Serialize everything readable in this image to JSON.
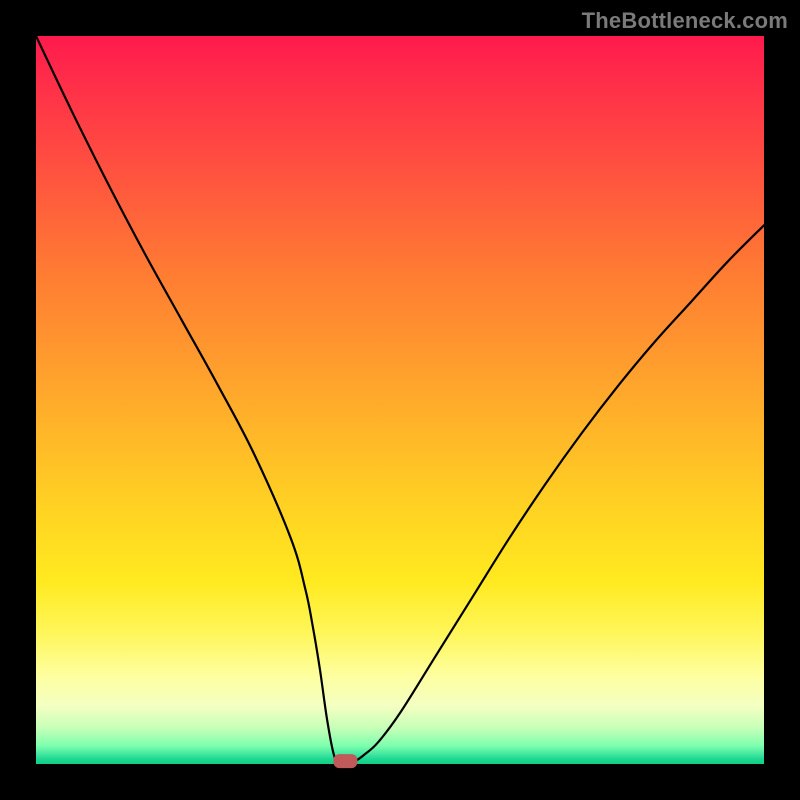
{
  "watermark": "TheBottleneck.com",
  "chart_data": {
    "type": "line",
    "title": "",
    "xlabel": "",
    "ylabel": "",
    "xlim": [
      0,
      100
    ],
    "ylim": [
      0,
      100
    ],
    "grid": false,
    "series": [
      {
        "name": "curve",
        "x": [
          0,
          5,
          10,
          15,
          20,
          25,
          30,
          35,
          37,
          38,
          39,
          40,
          41,
          42,
          43,
          44,
          45,
          47,
          50,
          55,
          60,
          65,
          70,
          75,
          80,
          85,
          90,
          95,
          100
        ],
        "values": [
          100,
          89.5,
          79.5,
          70,
          61,
          52,
          42.5,
          31,
          24,
          19,
          13,
          6,
          1,
          0.2,
          0.2,
          0.5,
          1.2,
          3,
          7,
          15,
          23,
          31,
          38.5,
          45.5,
          52,
          58,
          63.5,
          69,
          74
        ]
      }
    ],
    "annotations": [
      {
        "type": "marker",
        "shape": "rounded-rect",
        "x": 42.5,
        "y": 0.4,
        "color": "#c05a5a"
      }
    ],
    "background_gradient": {
      "top": "#ff1a4d",
      "bottom": "#0fcf86"
    }
  },
  "icons": {
    "marker": "rounded-rect-marker"
  }
}
